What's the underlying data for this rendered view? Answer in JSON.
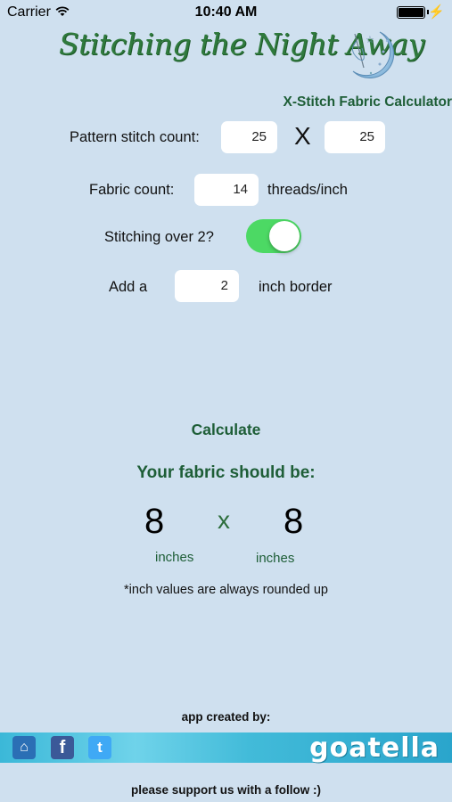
{
  "status_bar": {
    "carrier": "Carrier",
    "time": "10:40 AM"
  },
  "header": {
    "logo_text": "Stitching the Night Away",
    "subtitle": "X-Stitch Fabric Calculator"
  },
  "form": {
    "pattern_label": "Pattern stitch count:",
    "pattern_width": "25",
    "pattern_separator": "X",
    "pattern_height": "25",
    "fabric_label": "Fabric count:",
    "fabric_value": "14",
    "fabric_unit": "threads/inch",
    "over2_label": "Stitching over 2?",
    "over2_on": true,
    "border_prefix": "Add a",
    "border_value": "2",
    "border_suffix": "inch border"
  },
  "calculate_label": "Calculate",
  "result": {
    "heading": "Your fabric should be:",
    "width": "8",
    "separator": "x",
    "height": "8",
    "width_unit": "inches",
    "height_unit": "inches",
    "note": "*inch values are always rounded up"
  },
  "footer": {
    "credit": "app created by:",
    "brand": "goatella",
    "support": "please support us with a follow :)"
  },
  "colors": {
    "accent_green": "#1e5e37",
    "toggle_on": "#4cd964",
    "background": "#cfe0ef"
  }
}
